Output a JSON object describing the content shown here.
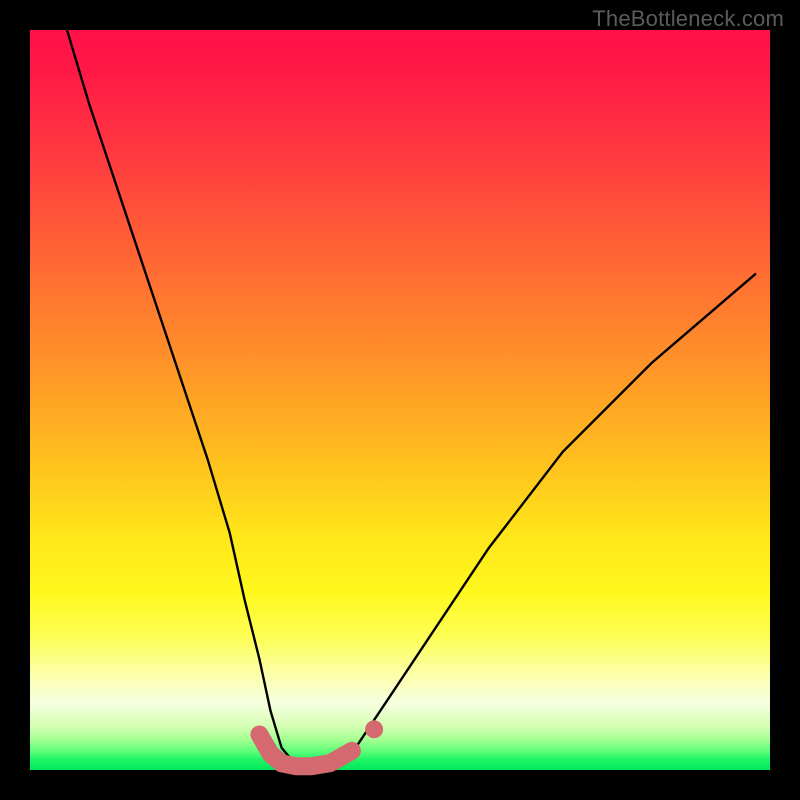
{
  "watermark": "TheBottleneck.com",
  "chart_data": {
    "type": "line",
    "title": "",
    "xlabel": "",
    "ylabel": "",
    "xlim": [
      0,
      100
    ],
    "ylim": [
      0,
      100
    ],
    "grid": false,
    "series": [
      {
        "name": "bottleneck-curve",
        "color": "#000000",
        "x": [
          5,
          8,
          12,
          16,
          20,
          24,
          27,
          29,
          31,
          32.5,
          34,
          36,
          38,
          40.5,
          44,
          48,
          54,
          62,
          72,
          84,
          98
        ],
        "values": [
          100,
          90,
          78,
          66,
          54,
          42,
          32,
          23,
          15,
          8,
          3,
          0.6,
          0.3,
          0.6,
          3,
          9,
          18,
          30,
          43,
          55,
          67
        ]
      },
      {
        "name": "highlight-band",
        "color": "#d46a6f",
        "x": [
          31,
          32.5,
          34,
          36,
          38,
          40.5,
          43.5
        ],
        "values": [
          4.8,
          2.2,
          0.9,
          0.5,
          0.5,
          0.9,
          2.6
        ]
      },
      {
        "name": "highlight-dot",
        "color": "#d46a6f",
        "x": [
          46.5
        ],
        "values": [
          5.5
        ]
      }
    ],
    "legend": false
  }
}
